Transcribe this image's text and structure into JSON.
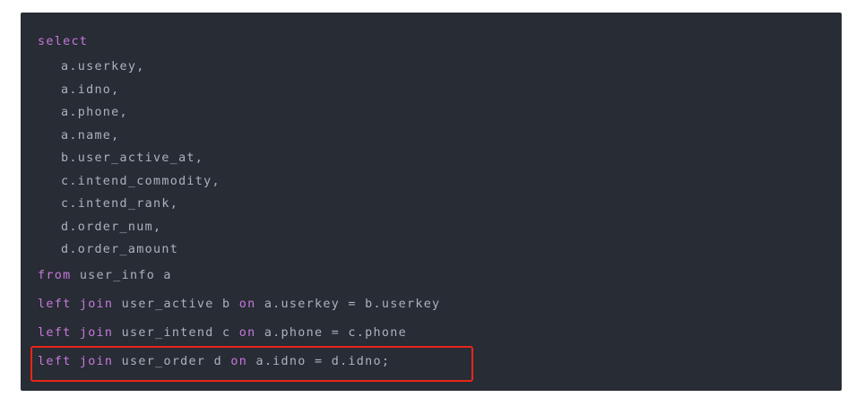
{
  "code": {
    "lines": [
      {
        "tokens": [
          {
            "t": "select",
            "kw": true
          }
        ]
      },
      {
        "tokens": [
          {
            "t": "a.userkey,",
            "kw": false
          }
        ]
      },
      {
        "tokens": [
          {
            "t": "a.idno,",
            "kw": false
          }
        ]
      },
      {
        "tokens": [
          {
            "t": "a.phone,",
            "kw": false
          }
        ]
      },
      {
        "tokens": [
          {
            "t": "a.name,",
            "kw": false
          }
        ]
      },
      {
        "tokens": [
          {
            "t": "b.user_active_at,",
            "kw": false
          }
        ]
      },
      {
        "tokens": [
          {
            "t": "c.intend_commodity,",
            "kw": false
          }
        ]
      },
      {
        "tokens": [
          {
            "t": "c.intend_rank,",
            "kw": false
          }
        ]
      },
      {
        "tokens": [
          {
            "t": "d.order_num,",
            "kw": false
          }
        ]
      },
      {
        "tokens": [
          {
            "t": "d.order_amount",
            "kw": false
          }
        ]
      },
      {
        "tokens": [
          {
            "t": "from",
            "kw": true
          },
          {
            "t": " user_info a",
            "kw": false
          }
        ]
      },
      {
        "tokens": [
          {
            "t": "left",
            "kw": true
          },
          {
            "t": " ",
            "kw": false
          },
          {
            "t": "join",
            "kw": true
          },
          {
            "t": " user_active b ",
            "kw": false
          },
          {
            "t": "on",
            "kw": true
          },
          {
            "t": " a.userkey = b.userkey",
            "kw": false
          }
        ]
      },
      {
        "tokens": [
          {
            "t": "left",
            "kw": true
          },
          {
            "t": " ",
            "kw": false
          },
          {
            "t": "join",
            "kw": true
          },
          {
            "t": " user_intend c ",
            "kw": false
          },
          {
            "t": "on",
            "kw": true
          },
          {
            "t": " a.phone = c.phone",
            "kw": false
          }
        ]
      },
      {
        "tokens": [
          {
            "t": "left",
            "kw": true
          },
          {
            "t": " ",
            "kw": false
          },
          {
            "t": "join",
            "kw": true
          },
          {
            "t": " user_order d ",
            "kw": false
          },
          {
            "t": "on",
            "kw": true
          },
          {
            "t": " a.idno = d.idno;",
            "kw": false
          }
        ]
      }
    ]
  },
  "colors": {
    "background": "#282c34",
    "keyword": "#c678dd",
    "text": "#abb2bf",
    "highlight_border": "#e8261a"
  }
}
